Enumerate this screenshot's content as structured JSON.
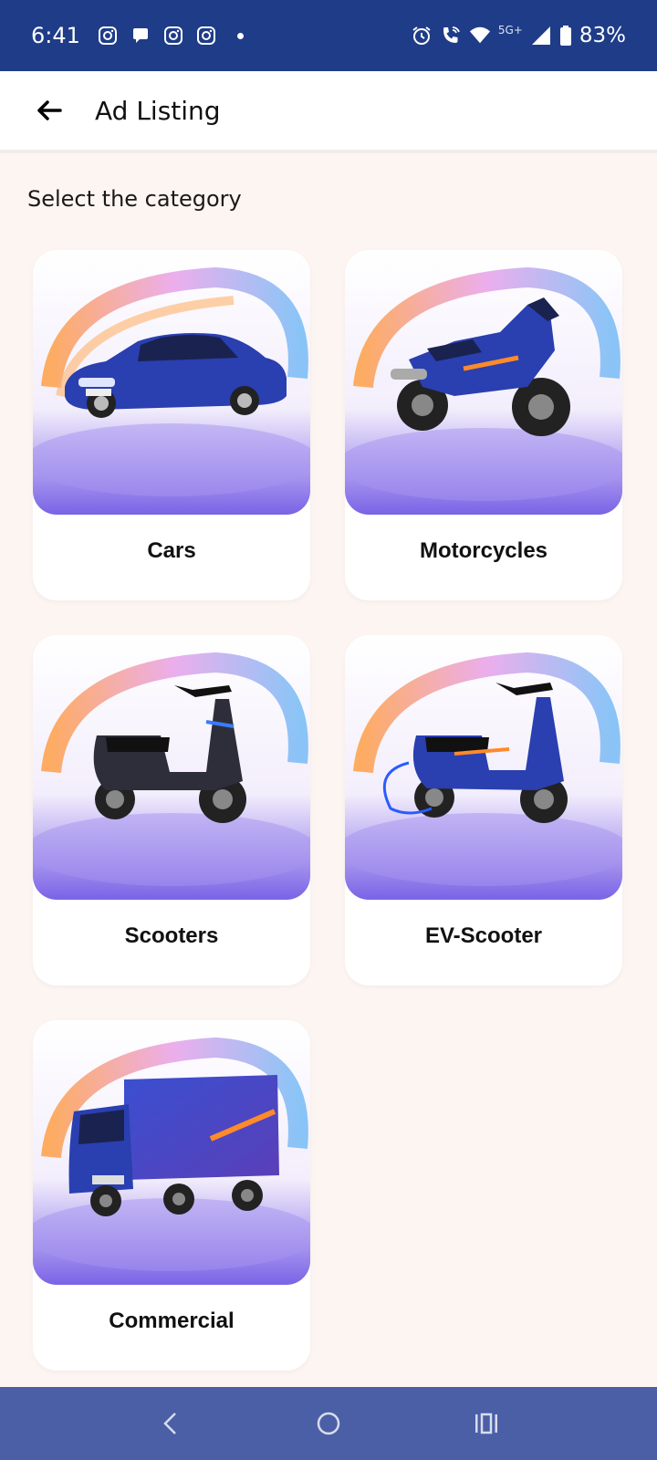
{
  "status_bar": {
    "time": "6:41",
    "network": "5G+",
    "battery": "83%",
    "icons_left": [
      "instagram-icon",
      "chat-icon",
      "instagram-icon",
      "instagram-icon"
    ],
    "icons_right": [
      "alarm-icon",
      "wifi-call-icon",
      "wifi-icon",
      "signal-icon",
      "battery-icon"
    ]
  },
  "header": {
    "title": "Ad Listing"
  },
  "content": {
    "section_title": "Select the category",
    "categories": [
      {
        "label": "Cars",
        "icon": "car-image"
      },
      {
        "label": "Motorcycles",
        "icon": "motorcycle-image"
      },
      {
        "label": "Scooters",
        "icon": "scooter-image"
      },
      {
        "label": "EV-Scooter",
        "icon": "ev-scooter-image"
      },
      {
        "label": "Commercial",
        "icon": "commercial-truck-image"
      }
    ]
  },
  "colors": {
    "status_bar": "#1f3c88",
    "nav_bar": "#4a5fa5",
    "background": "#fdf5f2",
    "vehicle_blue": "#2a3fb0"
  },
  "nav": {
    "items": [
      "back-icon",
      "home-icon",
      "recents-icon"
    ]
  }
}
